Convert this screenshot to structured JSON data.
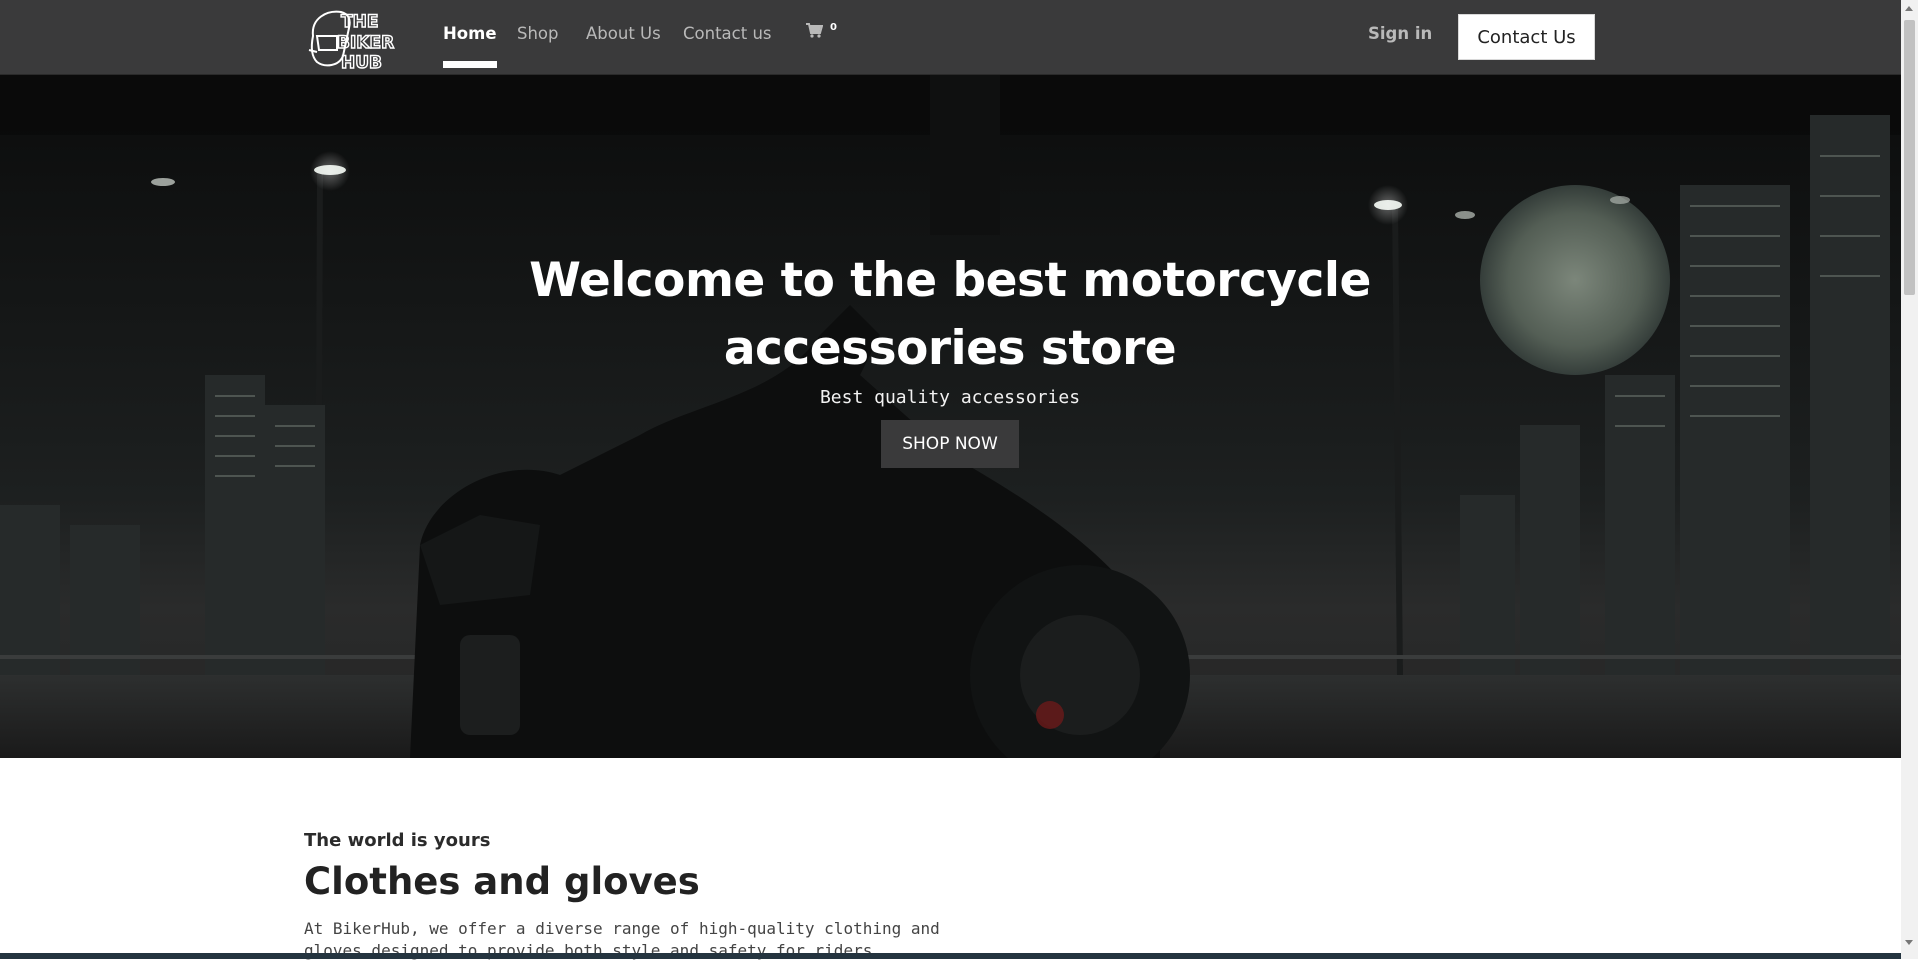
{
  "nav": {
    "logo_text": "THE BIKER HUB",
    "links": [
      {
        "label": "Home",
        "active": true
      },
      {
        "label": "Shop",
        "active": false
      },
      {
        "label": "About Us",
        "active": false
      },
      {
        "label": "Contact us",
        "active": false
      }
    ],
    "cart_icon": "shopping-cart-icon",
    "cart_count": "0",
    "signin_label": "Sign in",
    "contact_button": "Contact Us"
  },
  "hero": {
    "title": "Welcome to the best motorcycle accessories store",
    "subtitle": "Best quality accessories",
    "cta": "SHOP NOW"
  },
  "section": {
    "kicker": "The world is yours",
    "title": "Clothes and gloves",
    "text": "At BikerHub, we offer a diverse range of high-quality clothing and gloves designed to provide both style and safety for riders."
  },
  "colors": {
    "navbar_bg": "#3a3a3b",
    "cta_bg": "#3a3a3b",
    "accent": "#ffffff"
  }
}
